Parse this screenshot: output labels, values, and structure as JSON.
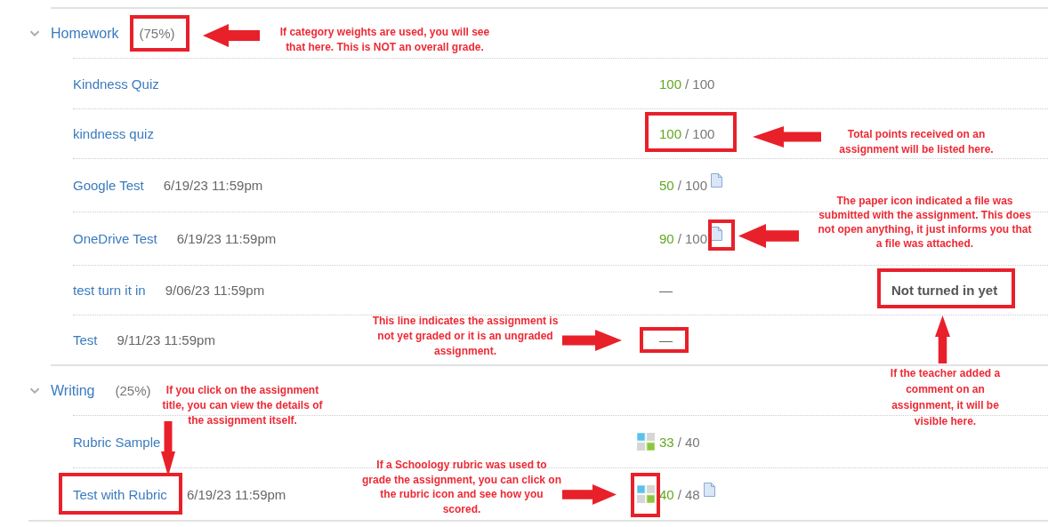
{
  "categories": [
    {
      "title": "Homework",
      "weight": "(75%)",
      "expanded": true,
      "items": [
        {
          "title": "Kindness Quiz",
          "score": "100",
          "max": "/ 100",
          "rubric": false,
          "file": false
        },
        {
          "title": "kindness quiz",
          "score": "100",
          "max": "/ 100",
          "rubric": false,
          "file": false
        },
        {
          "title": "Google Test",
          "due": "6/19/23 11:59pm",
          "score": "50",
          "max": "/ 100",
          "rubric": false,
          "file": true
        },
        {
          "title": "OneDrive Test",
          "due": "6/19/23 11:59pm",
          "score": "90",
          "max": "/ 100",
          "rubric": false,
          "file": true
        },
        {
          "title": "test turn it in",
          "due": "9/06/23 11:59pm",
          "ungraded": "—",
          "rubric": false,
          "file": false,
          "comment": "Not turned in yet"
        },
        {
          "title": "Test",
          "due": "9/11/23 11:59pm",
          "ungraded": "—",
          "rubric": false,
          "file": false
        }
      ]
    },
    {
      "title": "Writing",
      "weight": "(25%)",
      "expanded": true,
      "items": [
        {
          "title": "Rubric Sample",
          "score": "33",
          "max": "/ 40",
          "rubric": true,
          "file": false
        },
        {
          "title": "Test with Rubric",
          "due": "6/19/23 11:59pm",
          "score": "40",
          "max": "/ 48",
          "rubric": true,
          "file": true
        }
      ]
    }
  ],
  "annotation_notes": [
    "If category weights are used, you will see that here. This is NOT an overall grade.",
    "Total points received on an assignment will be listed here.",
    "The paper icon indicated a file was submitted with the assignment. This does not open anything, it just informs you that a file was attached.",
    "If the teacher added a comment on an assignment, it will be visible here.",
    "This line indicates the assignment is not yet graded or it is an ungraded assignment.",
    "If you click on the assignment title, you can view the details of the assignment itself.",
    "If a Schoology rubric was used to grade the assignment, you can click on the rubric icon and see how you scored."
  ]
}
